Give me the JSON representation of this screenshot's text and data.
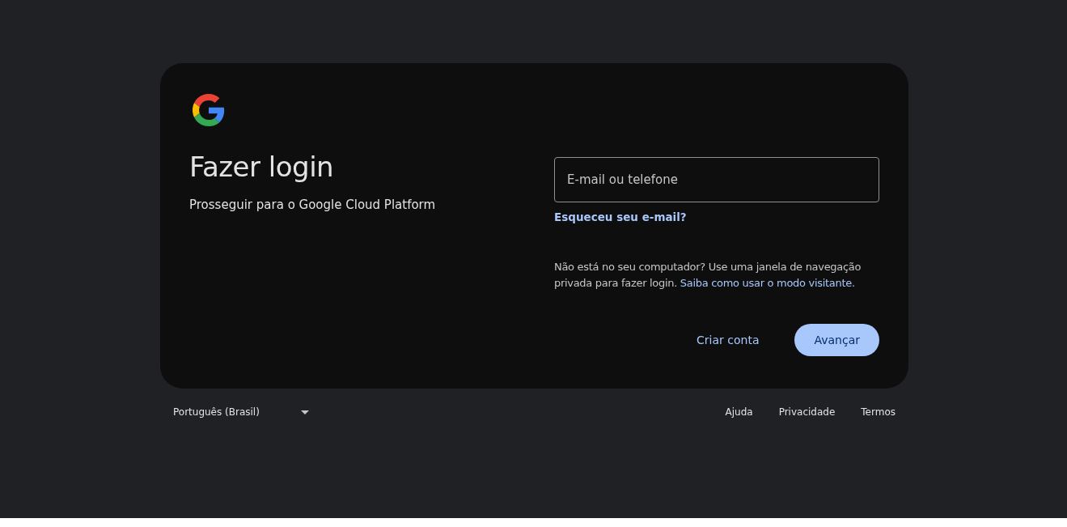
{
  "card": {
    "title": "Fazer login",
    "subtitle": "Prosseguir para o Google Cloud Platform",
    "email_field": {
      "placeholder": "E-mail ou telefone"
    },
    "forgot_link": "Esqueceu seu e-mail?",
    "notice": {
      "text": "Não está no seu computador? Use uma janela de navegação privada para fazer login.",
      "link": "Saiba como usar o modo visitante."
    },
    "buttons": [
      {
        "label": "Criar conta",
        "kind": "text"
      },
      {
        "label": "Avançar",
        "kind": "filled"
      }
    ]
  },
  "footer": {
    "language": "Português (Brasil)",
    "links": [
      "Ajuda",
      "Privacidade",
      "Termos"
    ]
  }
}
